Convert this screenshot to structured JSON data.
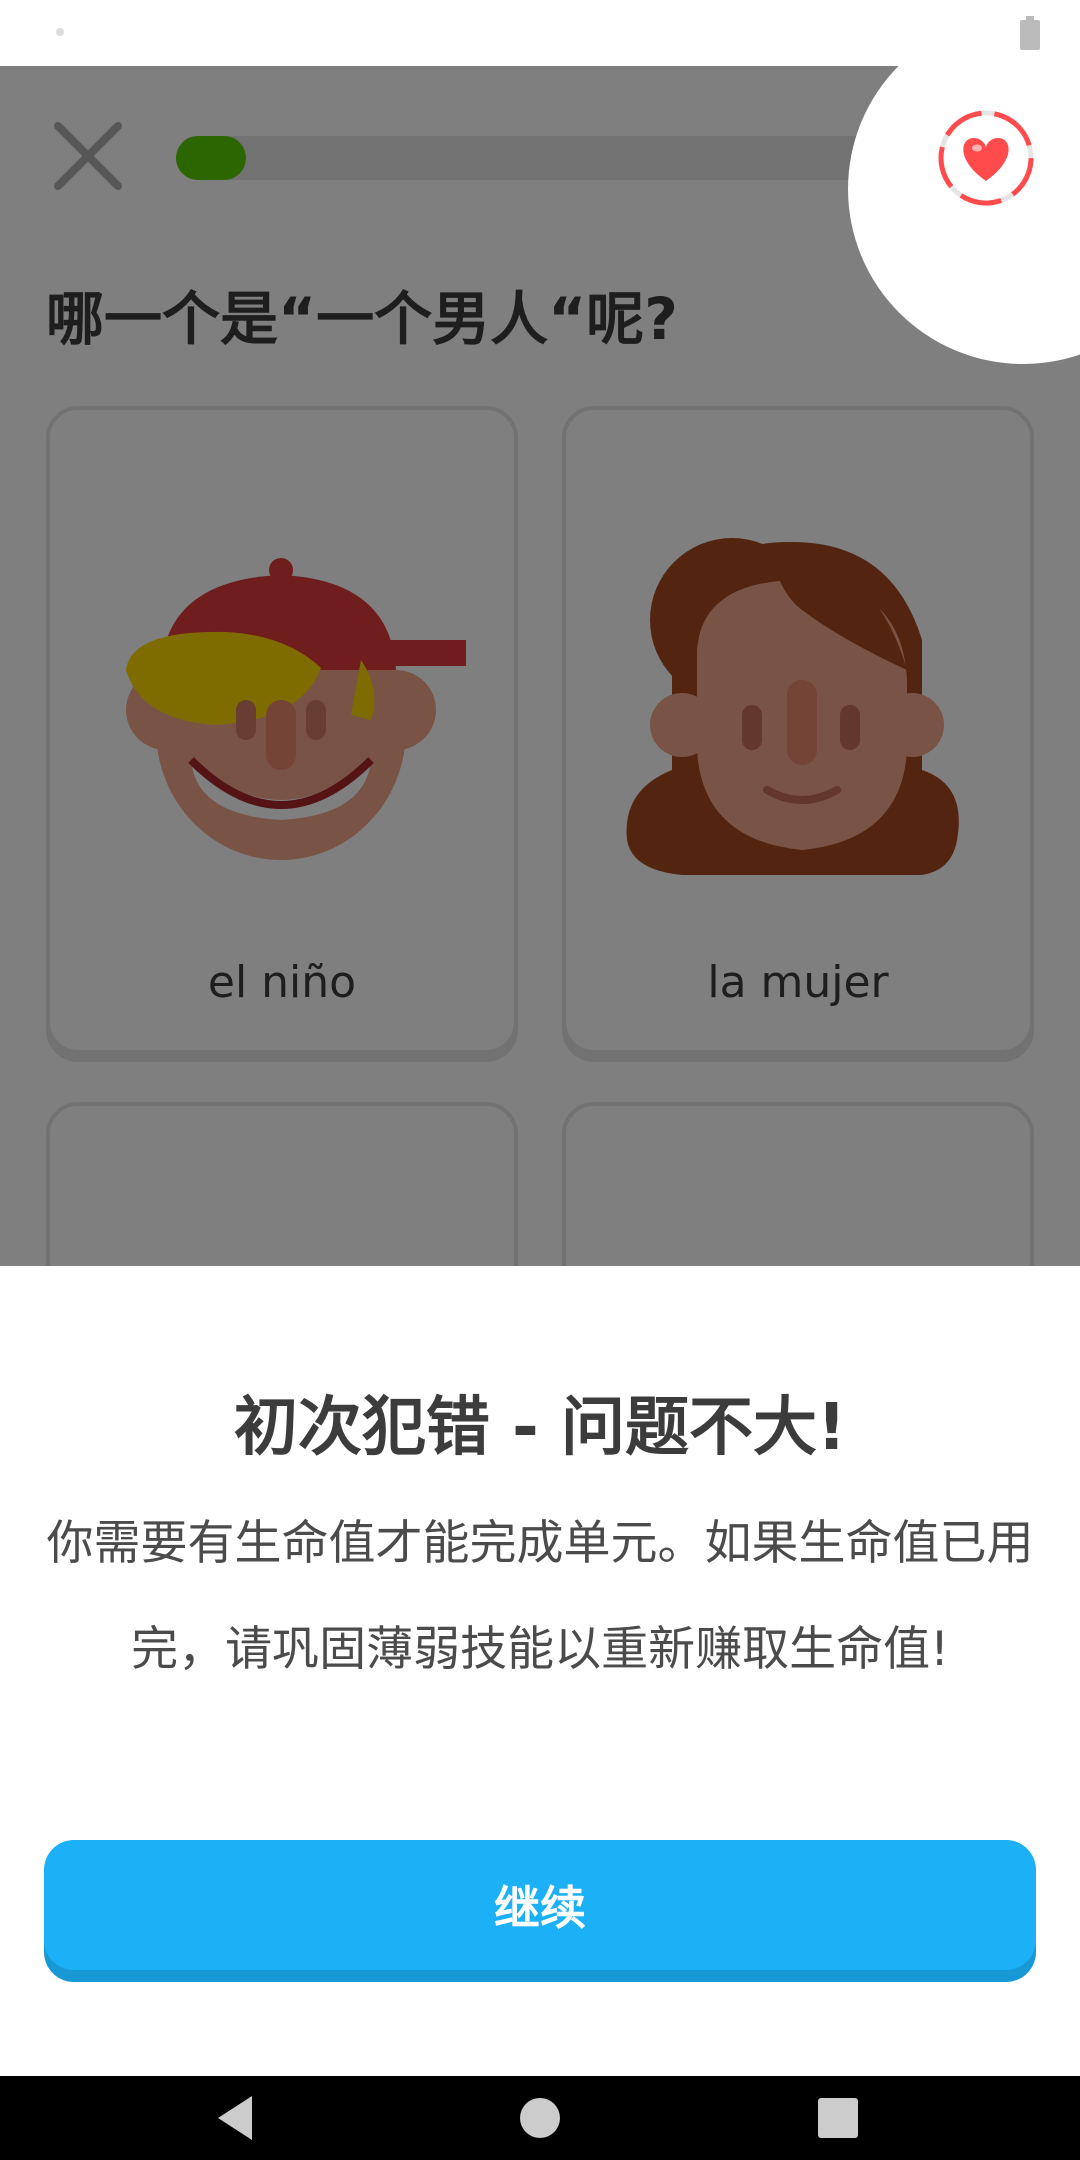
{
  "app": {
    "question": "哪一个是“一个男人“呢?",
    "progress_fraction": 0.1,
    "close_icon": "close-icon",
    "hearts_icon": "heart-icon"
  },
  "cards": [
    {
      "label": "el niño",
      "icon": "boy-with-cap-icon"
    },
    {
      "label": "la mujer",
      "icon": "woman-icon"
    },
    {
      "label": "",
      "icon": "person-icon"
    },
    {
      "label": "",
      "icon": "person-icon"
    }
  ],
  "sheet": {
    "title": "初次犯错 - 问题不大!",
    "body": "你需要有生命值才能完成单元。如果生命值已用完，请巩固薄弱技能以重新赚取生命值!",
    "continue_label": "继续"
  },
  "colors": {
    "progress": "#58cc02",
    "button": "#1cb0f6",
    "button_shadow": "#1899d6",
    "heart": "#ff4b4b"
  }
}
